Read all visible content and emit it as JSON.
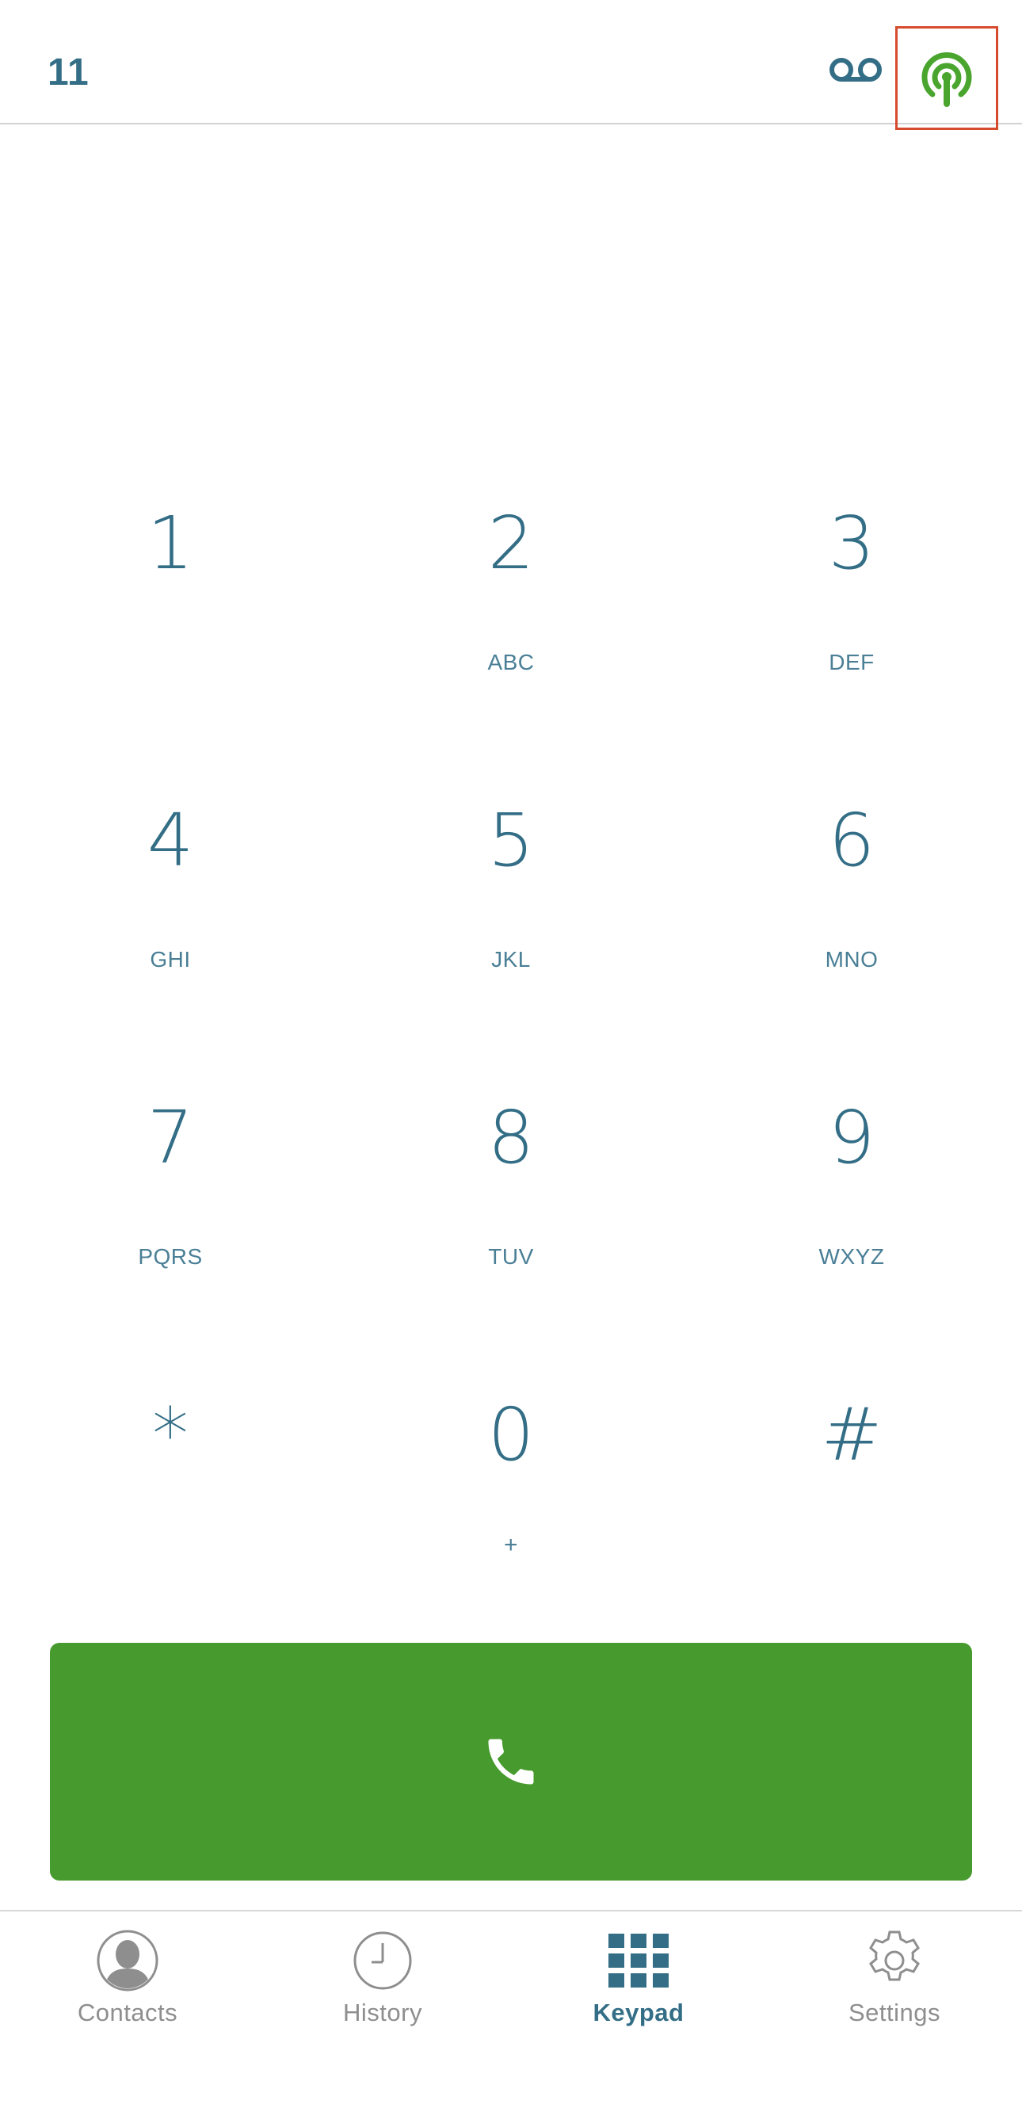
{
  "header": {
    "account_label": "11",
    "voicemail_icon": "voicemail-icon",
    "signal_icon": "broadcast-signal-icon"
  },
  "keypad": {
    "keys": [
      {
        "digit": "1",
        "letters": ""
      },
      {
        "digit": "2",
        "letters": "ABC"
      },
      {
        "digit": "3",
        "letters": "DEF"
      },
      {
        "digit": "4",
        "letters": "GHI"
      },
      {
        "digit": "5",
        "letters": "JKL"
      },
      {
        "digit": "6",
        "letters": "MNO"
      },
      {
        "digit": "7",
        "letters": "PQRS"
      },
      {
        "digit": "8",
        "letters": "TUV"
      },
      {
        "digit": "9",
        "letters": "WXYZ"
      },
      {
        "digit": "*",
        "letters": ""
      },
      {
        "digit": "0",
        "letters": "+"
      },
      {
        "digit": "#",
        "letters": ""
      }
    ]
  },
  "call_button": {
    "icon": "phone-icon"
  },
  "tabs": [
    {
      "label": "Contacts",
      "icon": "contact-silhouette-icon",
      "active": false
    },
    {
      "label": "History",
      "icon": "clock-icon",
      "active": false
    },
    {
      "label": "Keypad",
      "icon": "keypad-grid-icon",
      "active": true
    },
    {
      "label": "Settings",
      "icon": "gear-icon",
      "active": false
    }
  ],
  "colors": {
    "primary": "#336e86",
    "call_green": "#479a2d",
    "signal_green": "#4aa52e",
    "highlight_red": "#d64b2e",
    "tab_inactive": "#8e8e8e"
  }
}
